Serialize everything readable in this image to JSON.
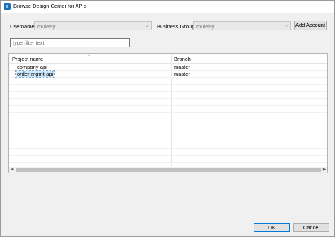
{
  "window": {
    "title": "Browse Design Center for APIs"
  },
  "form": {
    "username_label": "Username",
    "username_value": "muleisy",
    "business_group_label": "Business Group",
    "business_group_value": "muleisy",
    "add_account_label": "Add Account",
    "filter_placeholder": "type filter text",
    "filter_value": ""
  },
  "table": {
    "columns": [
      "Project name",
      "Branch"
    ],
    "rows": [
      {
        "project": "company-api",
        "branch": "master",
        "selected": false
      },
      {
        "project": "order-mgmt-api",
        "branch": "master",
        "selected": true
      }
    ]
  },
  "footer": {
    "ok_label": "OK",
    "cancel_label": "Cancel"
  },
  "icons": {
    "app": "anypoint-studio-icon",
    "combo": "chevron-down-icon",
    "sort": "sort-indicator-icon",
    "scroll_left": "chevron-left-icon",
    "scroll_right": "chevron-right-icon"
  },
  "colors": {
    "selection_bg": "#cce8ff",
    "default_button_border": "#0078d7"
  }
}
